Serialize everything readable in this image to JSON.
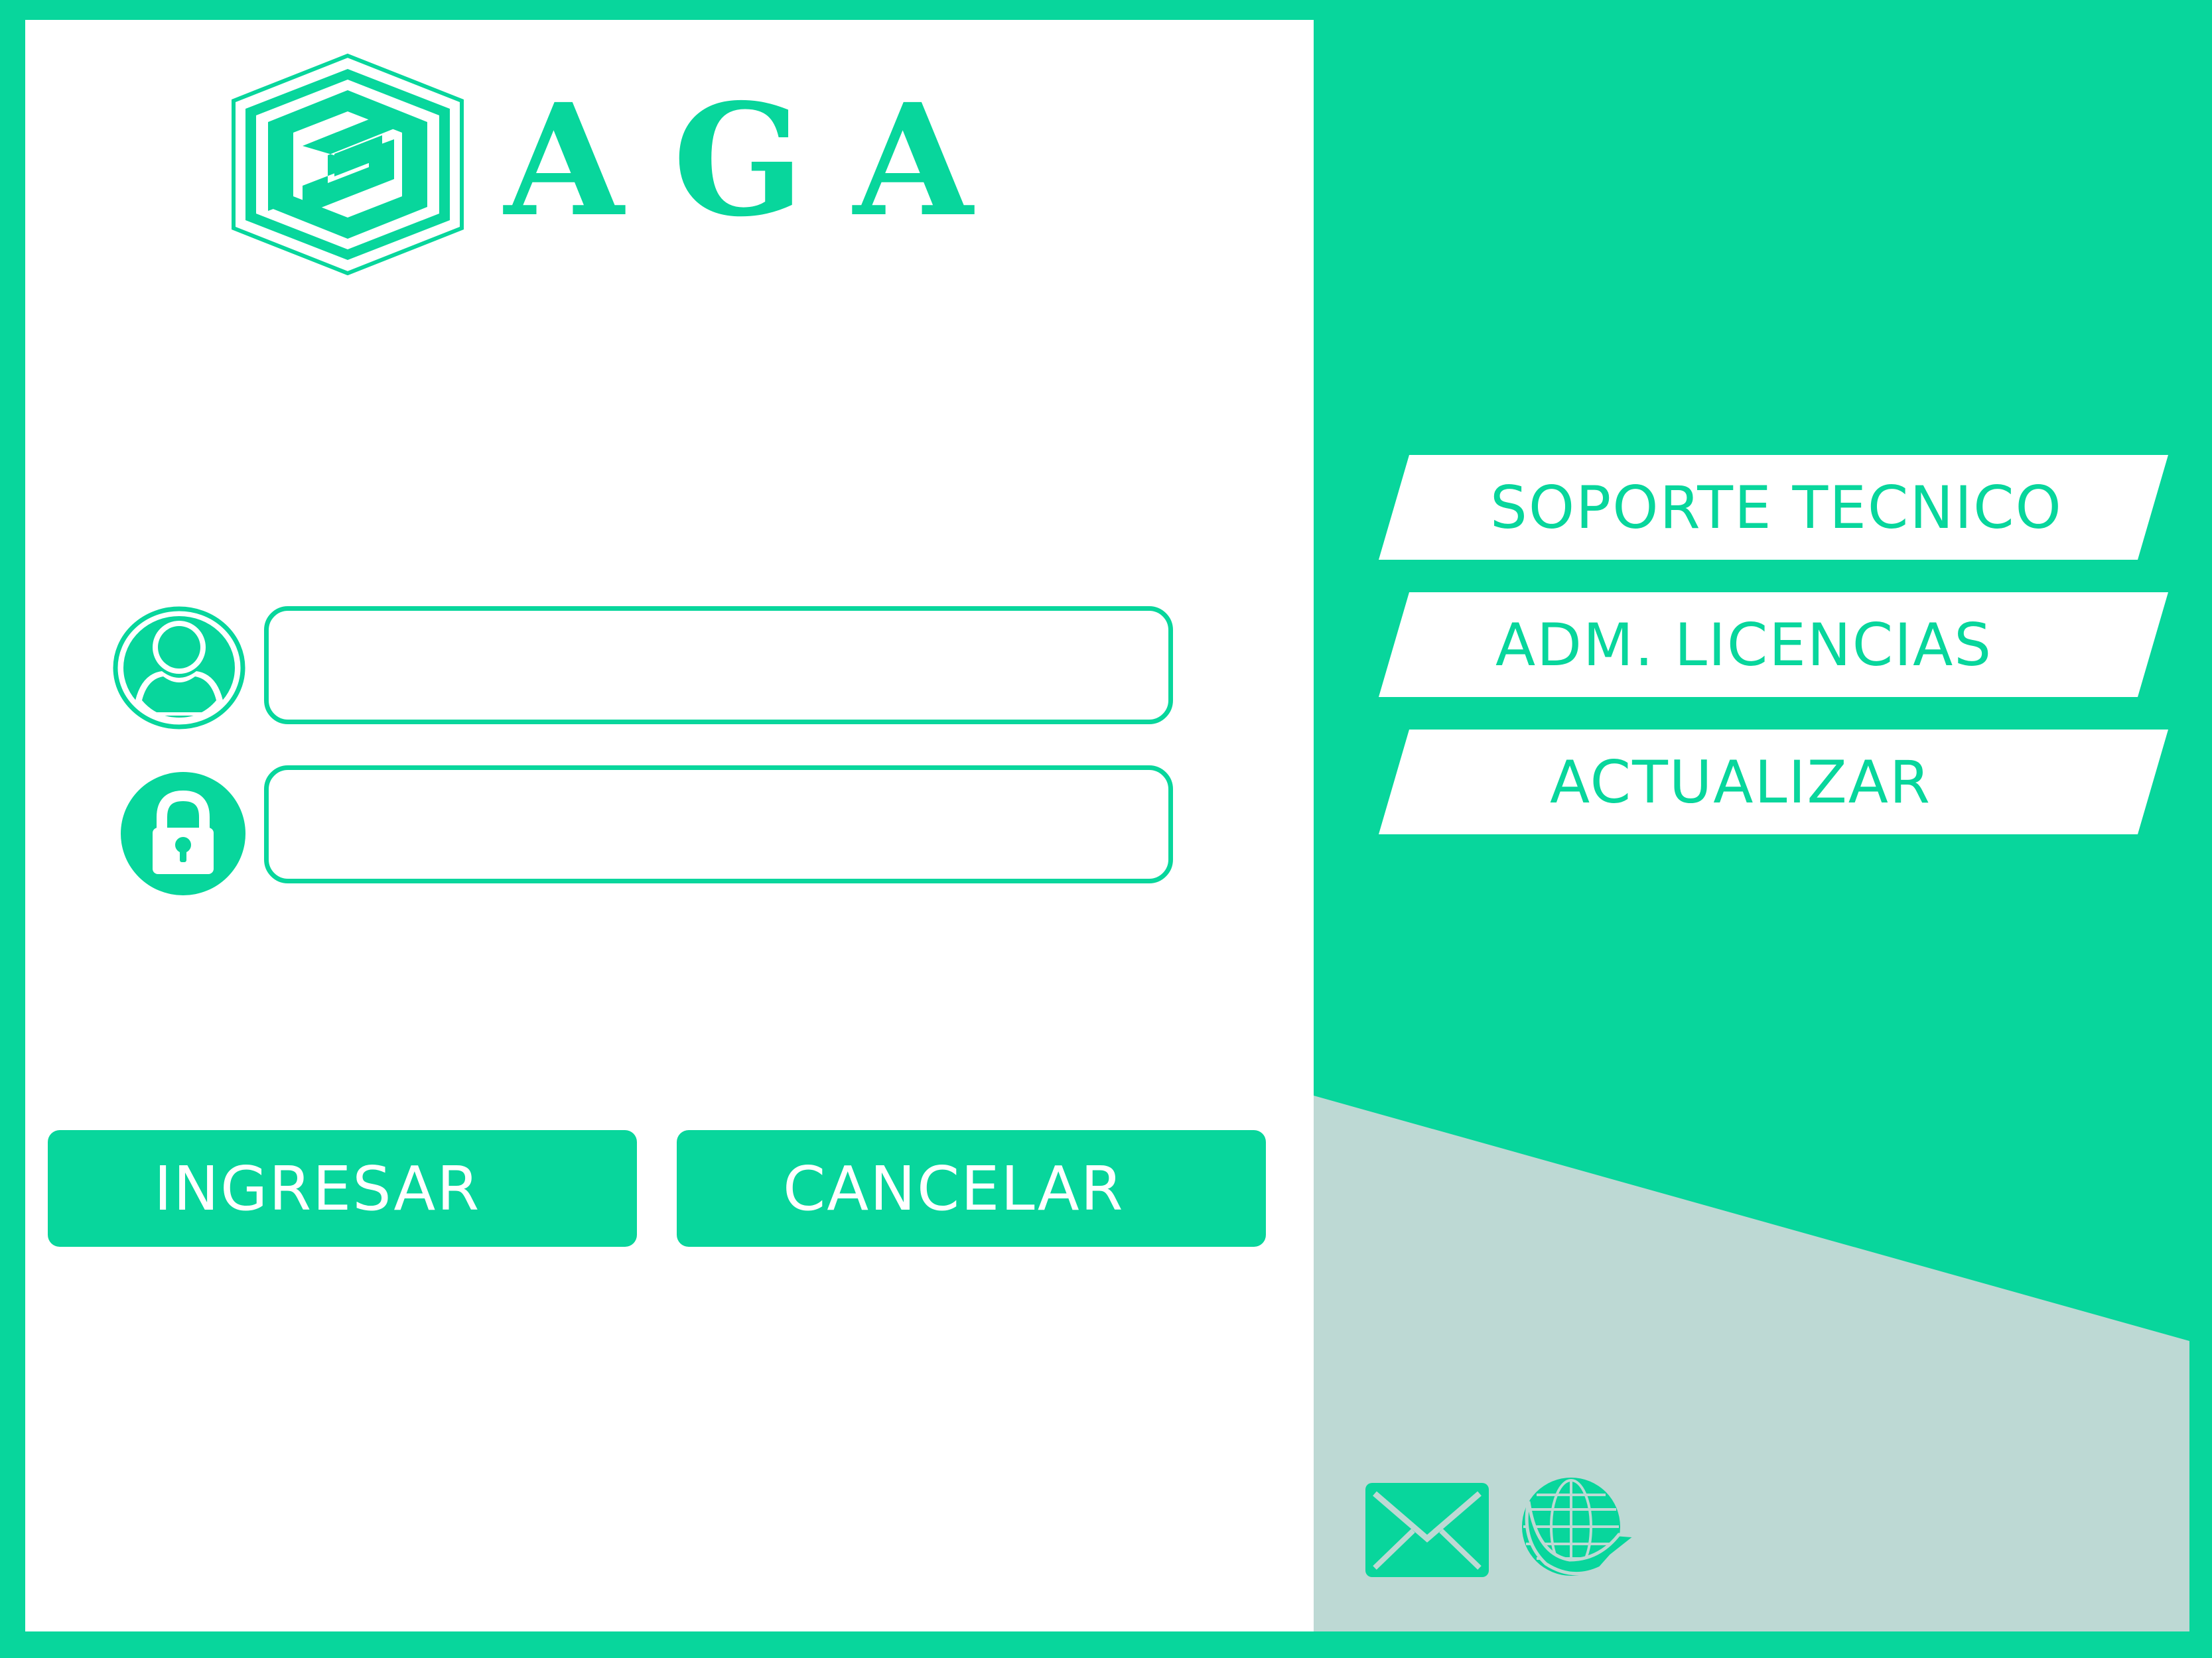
{
  "app": {
    "brand_name": "AGA"
  },
  "login": {
    "user_value": "",
    "password_value": ""
  },
  "actions": {
    "login_label": "INGRESAR",
    "cancel_label": "CANCELAR"
  },
  "side_menu": {
    "items": [
      {
        "label": "SOPORTE TECNICO"
      },
      {
        "label": "ADM. LICENCIAS"
      },
      {
        "label": "ACTUALIZAR"
      }
    ]
  },
  "colors": {
    "accent": "#08D69C",
    "panel": "#FFFFFF",
    "gray_area": "#BDD9D4"
  },
  "icons": {
    "logo": "hexagon-s-logo-icon",
    "user": "user-icon",
    "lock": "lock-icon",
    "mail": "mail-icon",
    "web": "globe-icon"
  }
}
